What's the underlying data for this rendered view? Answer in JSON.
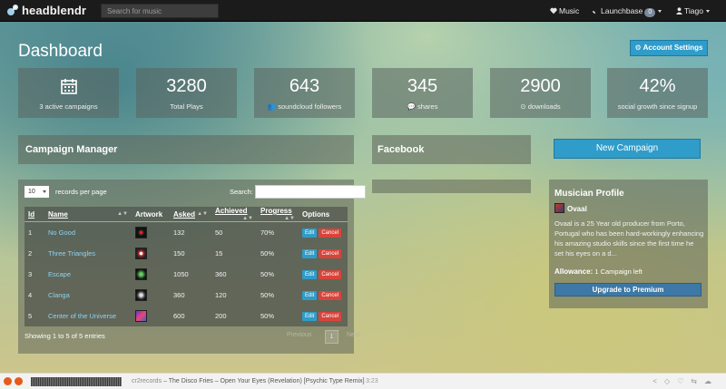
{
  "navbar": {
    "brand": "headblendr",
    "search_placeholder": "Search for music",
    "music_label": "Music",
    "launchbase_label": "Launchbase",
    "launchbase_badge": "0",
    "user_name": "Tiago"
  },
  "page": {
    "title": "Dashboard",
    "account_settings_label": "Account Settings"
  },
  "stats": [
    {
      "value": "",
      "label": "3 active campaigns",
      "icon": "calendar-icon"
    },
    {
      "value": "3280",
      "label": "Total Plays"
    },
    {
      "value": "643",
      "label": "soundcloud followers",
      "icon": "users-icon"
    },
    {
      "value": "345",
      "label": "shares",
      "icon": "comments-icon"
    },
    {
      "value": "2900",
      "label": "downloads",
      "icon": "download-icon"
    },
    {
      "value": "42%",
      "label": "social growth since signup"
    }
  ],
  "campaign_manager": {
    "title": "Campaign Manager",
    "length_value": "10",
    "length_label": "records per page",
    "search_label": "Search:",
    "columns": [
      "Id",
      "Name",
      "Artwork",
      "Asked",
      "Achieved",
      "Progress",
      "Options"
    ],
    "rows": [
      {
        "id": "1",
        "name": "No Good",
        "asked": "132",
        "achieved": "50",
        "progress": "70%"
      },
      {
        "id": "2",
        "name": "Three Triangles",
        "asked": "150",
        "achieved": "15",
        "progress": "50%"
      },
      {
        "id": "3",
        "name": "Escape",
        "asked": "1050",
        "achieved": "360",
        "progress": "50%"
      },
      {
        "id": "4",
        "name": "Clanga",
        "asked": "360",
        "achieved": "120",
        "progress": "50%"
      },
      {
        "id": "5",
        "name": "Center of the Universe",
        "asked": "600",
        "achieved": "200",
        "progress": "50%"
      }
    ],
    "edit_label": "Edit",
    "cancel_label": "Cancel",
    "entries_info": "Showing 1 to 5 of 5 entries",
    "pager_prev": "Previous",
    "pager_page": "1",
    "pager_next": "Next"
  },
  "facebook": {
    "title": "Facebook"
  },
  "new_campaign_label": "New Campaign",
  "profile": {
    "title": "Musician Profile",
    "artist_name": "Ovaal",
    "bio": "Ovaal is a 25 Year old producer from Porto, Portugal who has been hard-workingly enhancing his amazing studio skills since the first time he set his eyes on a d...",
    "allowance_label": "Allowance:",
    "allowance_value": "1 Campaign left",
    "upgrade_label": "Upgrade to Premium"
  },
  "player": {
    "artist": "cr2records",
    "separator": " – ",
    "track": "The Disco Fries – Open Your Eyes (Revelation) [Psychic Type Remix]",
    "duration": "3:23"
  },
  "colors": {
    "accent": "#2f9cc9",
    "danger": "#d9443a",
    "navbar": "#1b1b1b",
    "link": "#8fd3f2"
  }
}
